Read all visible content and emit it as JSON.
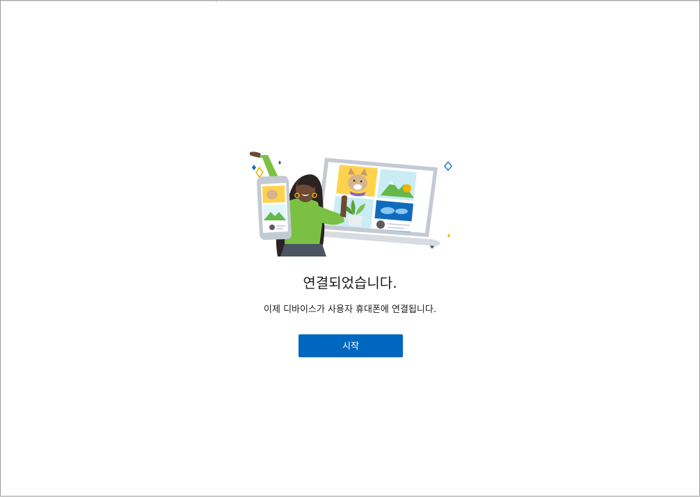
{
  "dialog": {
    "title": "연결되었습니다.",
    "message": "이제 디바이스가 사용자 휴대폰에 연결됩니다.",
    "start_button_label": "시작"
  },
  "colors": {
    "accent": "#0067c0",
    "shirt": "#7ac143",
    "sky": "#c9ecf5",
    "yellow": "#ffd24d",
    "frame": "#b9c0c9"
  },
  "illustration": {
    "description_icon": "connected-devices-illustration"
  }
}
